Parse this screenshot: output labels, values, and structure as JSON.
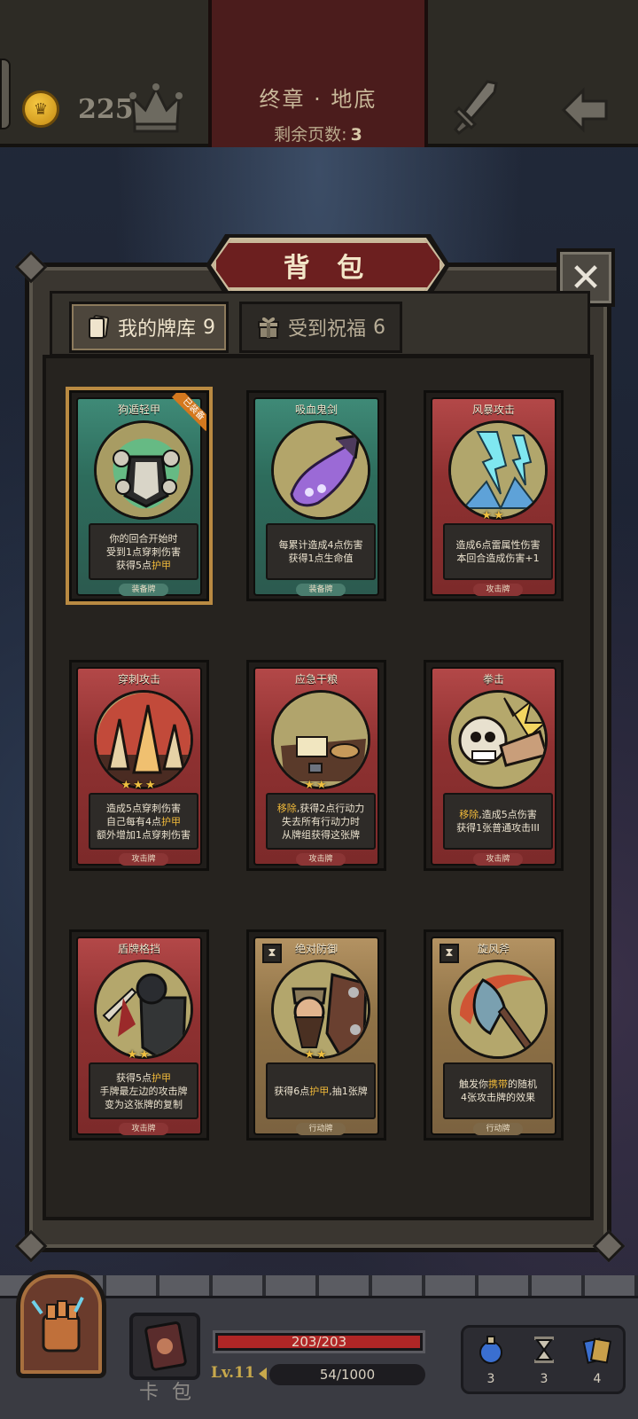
{
  "top_bar": {
    "coins": "225",
    "chapter_title": "终章 · 地底",
    "pages_left_label": "剩余页数:",
    "pages_left_value": "3"
  },
  "panel": {
    "title": "背 包",
    "close": "✕",
    "tabs": [
      {
        "label": "我的牌库",
        "count": "9"
      },
      {
        "label": "受到祝福",
        "count": "6"
      }
    ]
  },
  "cards": [
    {
      "name": "狗遁轻甲",
      "color": "green",
      "type": "装备牌",
      "stars": "",
      "ribbon": "已装备",
      "hourglass": false,
      "lines": [
        {
          "t": "你的回合开始时"
        },
        {
          "t": "受到1点穿刺伤害"
        },
        {
          "t": "获得5点",
          "h": "护甲"
        }
      ]
    },
    {
      "name": "吸血鬼剑",
      "color": "green",
      "type": "装备牌",
      "stars": "",
      "ribbon": "",
      "hourglass": false,
      "lines": [
        {
          "t": "每累计造成4点伤害"
        },
        {
          "t": "获得1点生命值"
        }
      ]
    },
    {
      "name": "风暴攻击",
      "color": "red",
      "type": "攻击牌",
      "stars": "★★",
      "ribbon": "",
      "hourglass": false,
      "lines": [
        {
          "t": "造成6点雷属性伤害"
        },
        {
          "t": "本回合造成伤害+1"
        }
      ]
    },
    {
      "name": "穿刺攻击",
      "color": "red",
      "type": "攻击牌",
      "stars": "★★★",
      "ribbon": "",
      "hourglass": false,
      "lines": [
        {
          "t": "造成5点穿刺伤害"
        },
        {
          "t": "自己每有4点",
          "h": "护甲"
        },
        {
          "t": "额外增加1点穿刺伤害"
        }
      ]
    },
    {
      "name": "应急干粮",
      "color": "red",
      "type": "攻击牌",
      "stars": "★★",
      "ribbon": "",
      "hourglass": false,
      "lines": [
        {
          "p": "移除",
          "t": ",获得2点行动力"
        },
        {
          "t": "失去所有行动力时"
        },
        {
          "t": "从牌组获得这张牌"
        }
      ]
    },
    {
      "name": "拳击",
      "color": "red",
      "type": "攻击牌",
      "stars": "",
      "ribbon": "",
      "hourglass": false,
      "lines": [
        {
          "p": "移除",
          "t": ",造成5点伤害"
        },
        {
          "t": "获得1张普通攻击III"
        }
      ]
    },
    {
      "name": "盾牌格挡",
      "color": "red",
      "type": "攻击牌",
      "stars": "★★",
      "ribbon": "",
      "hourglass": false,
      "lines": [
        {
          "t": "获得5点",
          "h": "护甲"
        },
        {
          "t": "手牌最左边的攻击牌"
        },
        {
          "t": "变为这张牌的复制"
        }
      ]
    },
    {
      "name": "绝对防御",
      "color": "tan",
      "type": "行动牌",
      "stars": "★★",
      "ribbon": "",
      "hourglass": true,
      "lines": [
        {
          "t": "获得6点",
          "h": "护甲",
          "s": ",抽1张牌"
        }
      ]
    },
    {
      "name": "旋风斧",
      "color": "tan",
      "type": "行动牌",
      "stars": "",
      "ribbon": "",
      "hourglass": true,
      "lines": [
        {
          "t": "触发你",
          "h": "携带",
          "s": "的随机"
        },
        {
          "t": "4张攻击牌的效果"
        }
      ]
    }
  ],
  "hud": {
    "deck_label": "卡 包",
    "hp_current": 203,
    "hp_max": 203,
    "hp_text": "203/203",
    "level": "Lv.11",
    "xp_current": 54,
    "xp_max": 1000,
    "xp_text": "54/1000",
    "resources": [
      {
        "icon": "potion-icon",
        "value": "3"
      },
      {
        "icon": "hourglass-icon",
        "value": "3"
      },
      {
        "icon": "cards-icon",
        "value": "4"
      }
    ]
  },
  "colors": {
    "accent_gold": "#f0b93a",
    "hp_red": "#b02626",
    "banner_red": "#6c1f1f"
  }
}
